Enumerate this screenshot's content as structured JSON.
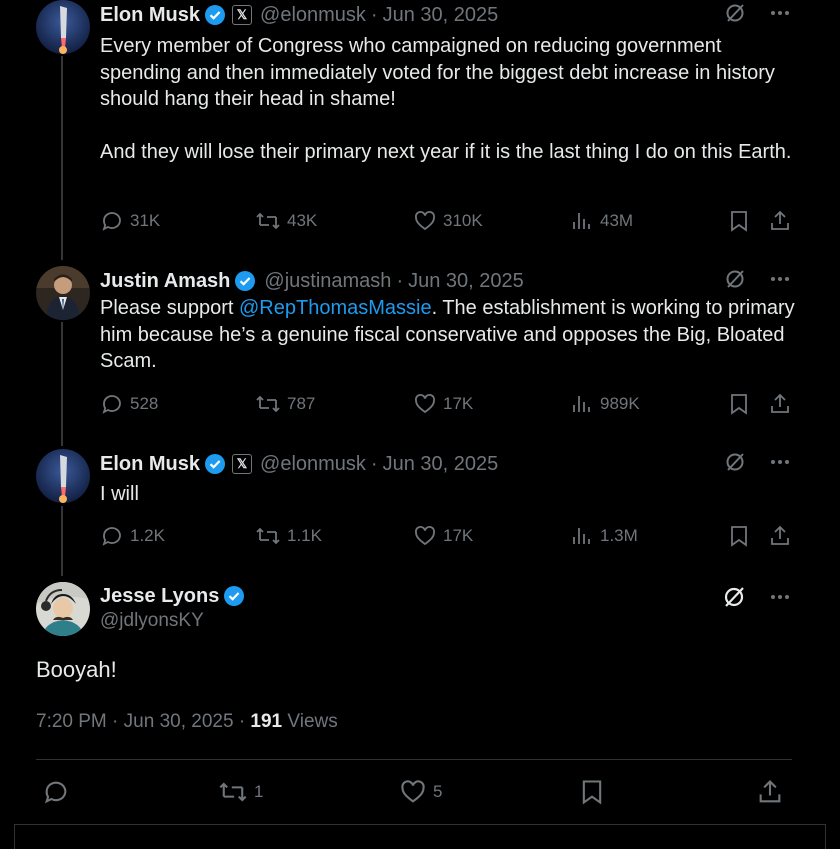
{
  "thread": [
    {
      "name": "Elon Musk",
      "handle": "@elonmusk",
      "date": "Jun 30, 2025",
      "text": "Every member of Congress who campaigned on reducing government spending and then immediately voted for the biggest debt increase in history should hang their head in shame!\n\nAnd they will lose their primary next year if it is the last thing I do on this Earth.",
      "stats": {
        "replies": "31K",
        "reposts": "43K",
        "likes": "310K",
        "views": "43M"
      }
    },
    {
      "name": "Justin Amash",
      "handle": "@justinamash",
      "date": "Jun 30, 2025",
      "text_before": "Please support ",
      "mention": "@RepThomasMassie",
      "text_after": ". The establishment is working to primary him because he’s a genuine fiscal conservative and opposes the Big, Bloated Scam.",
      "stats": {
        "replies": "528",
        "reposts": "787",
        "likes": "17K",
        "views": "989K"
      }
    },
    {
      "name": "Elon Musk",
      "handle": "@elonmusk",
      "date": "Jun 30, 2025",
      "text": "I will",
      "stats": {
        "replies": "1.2K",
        "reposts": "1.1K",
        "likes": "17K",
        "views": "1.3M"
      }
    }
  ],
  "main": {
    "name": "Jesse Lyons",
    "handle": "@jdlyonsKY",
    "text": "Booyah!",
    "time": "7:20 PM",
    "date": "Jun 30, 2025",
    "views_count": "191",
    "views_label": "Views",
    "reposts": "1",
    "likes": "5"
  },
  "separator": "·",
  "colors": {
    "background": "#000000",
    "text": "#e7e9ea",
    "muted": "#71767b",
    "accent": "#1d9bf0",
    "verified": "#1d9bf0"
  },
  "icons": [
    "grok-icon",
    "more-icon",
    "reply-icon",
    "repost-icon",
    "like-icon",
    "views-icon",
    "bookmark-icon",
    "share-icon",
    "verified-icon",
    "x-affiliate-icon"
  ]
}
